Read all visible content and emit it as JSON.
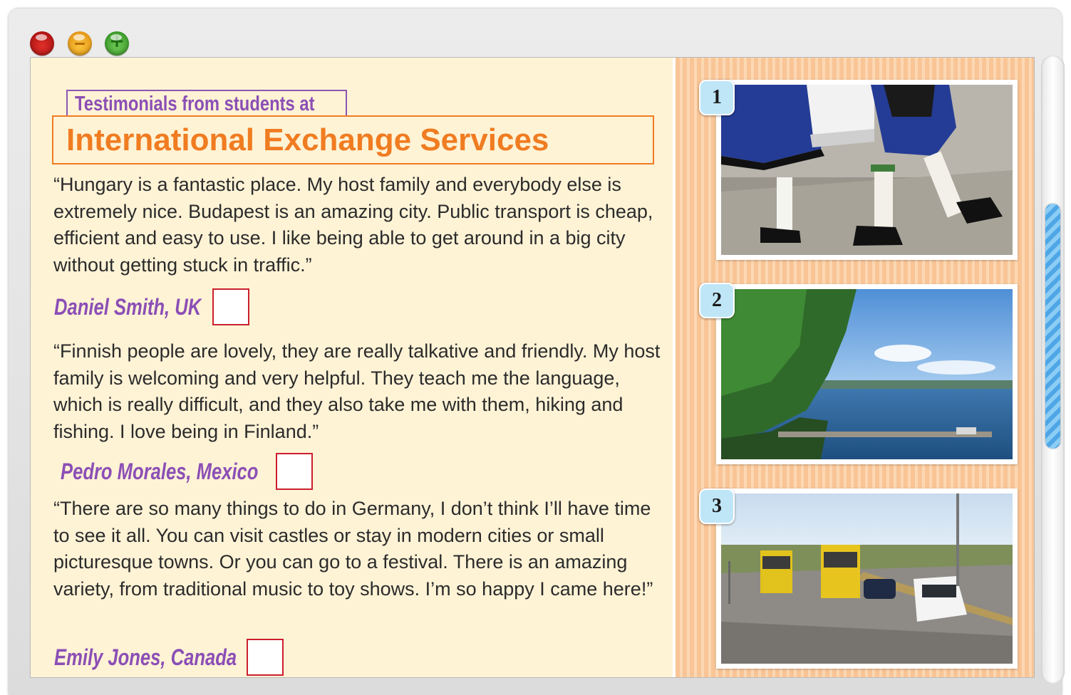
{
  "window": {
    "controls": [
      "close",
      "minimize",
      "maximize"
    ]
  },
  "header": {
    "subtitle": "Testimonials from students at",
    "title": "International Exchange Services"
  },
  "testimonials": [
    {
      "quote": "“Hungary is a fantastic place. My host family and everybody else is extremely nice. Budapest is an amazing city. Public transport is cheap, efficient and easy to use. I like being able to get around in a big city without getting stuck in traffic.”",
      "author": "Daniel Smith, UK",
      "answer": ""
    },
    {
      "quote": "“Finnish people are lovely, they are really talkative and friendly. My host family is welcoming and very helpful. They teach me the language, which is really difficult, and they also take me with them, hiking and fishing. I love being in Finland.”",
      "author": "Pedro Morales, Mexico",
      "answer": ""
    },
    {
      "quote": "“There are so many things to do in Germany, I don’t think I’ll have time to see it all. You can visit castles or stay in modern cities or small picturesque towns. Or you can go to a festival. There is an amazing variety, from traditional music to toy shows. I’m so happy I came here!”",
      "author": "Emily Jones, Canada",
      "answer": ""
    }
  ],
  "photos": [
    {
      "number": "1",
      "subject": "folk-dancers-photo"
    },
    {
      "number": "2",
      "subject": "lake-forest-photo"
    },
    {
      "number": "3",
      "subject": "tram-street-photo"
    }
  ],
  "colors": {
    "accent_orange": "#f07c21",
    "accent_purple": "#8b4fb5",
    "answer_box_border": "#cc1f2c",
    "left_pane_bg": "#fff3d6",
    "badge_bg": "#bfe6f7"
  }
}
